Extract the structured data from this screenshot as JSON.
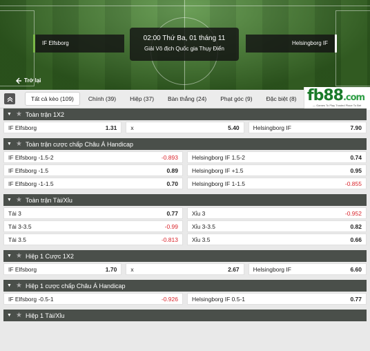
{
  "header": {
    "match_time": "02:00 Thứ Ba, 01 tháng 11",
    "league": "Giải Vô địch Quốc gia Thụy Điển",
    "home_team": "IF Elfsborg",
    "away_team": "Helsingborg IF",
    "back_label": "Trở lại"
  },
  "tabs": [
    {
      "label": "Tất cả kèo (109)",
      "active": true
    },
    {
      "label": "Chính (39)"
    },
    {
      "label": "Hiệp (37)"
    },
    {
      "label": "Bàn thắng (24)"
    },
    {
      "label": "Phạt góc (9)"
    },
    {
      "label": "Đặc biệt (8)"
    }
  ],
  "logo": {
    "text_main": "fb",
    "text_num": "88",
    "text_domain": ".com",
    "tagline": "— Games To Play    Trusted Place To Bet"
  },
  "markets": [
    {
      "title": "Toàn trận 1X2",
      "type": "3way",
      "rows": [
        [
          {
            "label": "IF Elfsborg",
            "odds": "1.31"
          },
          {
            "label": "x",
            "odds": "5.40"
          },
          {
            "label": "Helsingborg IF",
            "odds": "7.90"
          }
        ]
      ]
    },
    {
      "title": "Toàn trận cược chấp Châu Á Handicap",
      "type": "2way",
      "rows": [
        [
          {
            "label": "IF Elfsborg -1.5-2",
            "odds": "-0.893",
            "neg": true
          },
          {
            "label": "Helsingborg IF 1.5-2",
            "odds": "0.74"
          }
        ],
        [
          {
            "label": "IF Elfsborg -1.5",
            "odds": "0.89"
          },
          {
            "label": "Helsingborg IF +1.5",
            "odds": "0.95"
          }
        ],
        [
          {
            "label": "IF Elfsborg -1-1.5",
            "odds": "0.70"
          },
          {
            "label": "Helsingborg IF 1-1.5",
            "odds": "-0.855",
            "neg": true
          }
        ]
      ]
    },
    {
      "title": "Toàn trận Tài/Xỉu",
      "type": "2way",
      "rows": [
        [
          {
            "label": "Tài 3",
            "odds": "0.77"
          },
          {
            "label": "Xỉu 3",
            "odds": "-0.952",
            "neg": true
          }
        ],
        [
          {
            "label": "Tài 3-3.5",
            "odds": "-0.99",
            "neg": true
          },
          {
            "label": "Xỉu 3-3.5",
            "odds": "0.82"
          }
        ],
        [
          {
            "label": "Tài 3.5",
            "odds": "-0.813",
            "neg": true
          },
          {
            "label": "Xỉu 3.5",
            "odds": "0.66"
          }
        ]
      ]
    },
    {
      "title": "Hiệp 1 Cược 1X2",
      "type": "3way",
      "rows": [
        [
          {
            "label": "IF Elfsborg",
            "odds": "1.70"
          },
          {
            "label": "x",
            "odds": "2.67"
          },
          {
            "label": "Helsingborg IF",
            "odds": "6.60"
          }
        ]
      ]
    },
    {
      "title": "Hiệp 1 cược chấp Châu Á Handicap",
      "type": "2way",
      "rows": [
        [
          {
            "label": "IF Elfsborg -0.5-1",
            "odds": "-0.926",
            "neg": true
          },
          {
            "label": "Helsingborg IF 0.5-1",
            "odds": "0.77"
          }
        ]
      ]
    },
    {
      "title": "Hiệp 1 Tài/Xỉu",
      "type": "2way",
      "rows": []
    }
  ]
}
